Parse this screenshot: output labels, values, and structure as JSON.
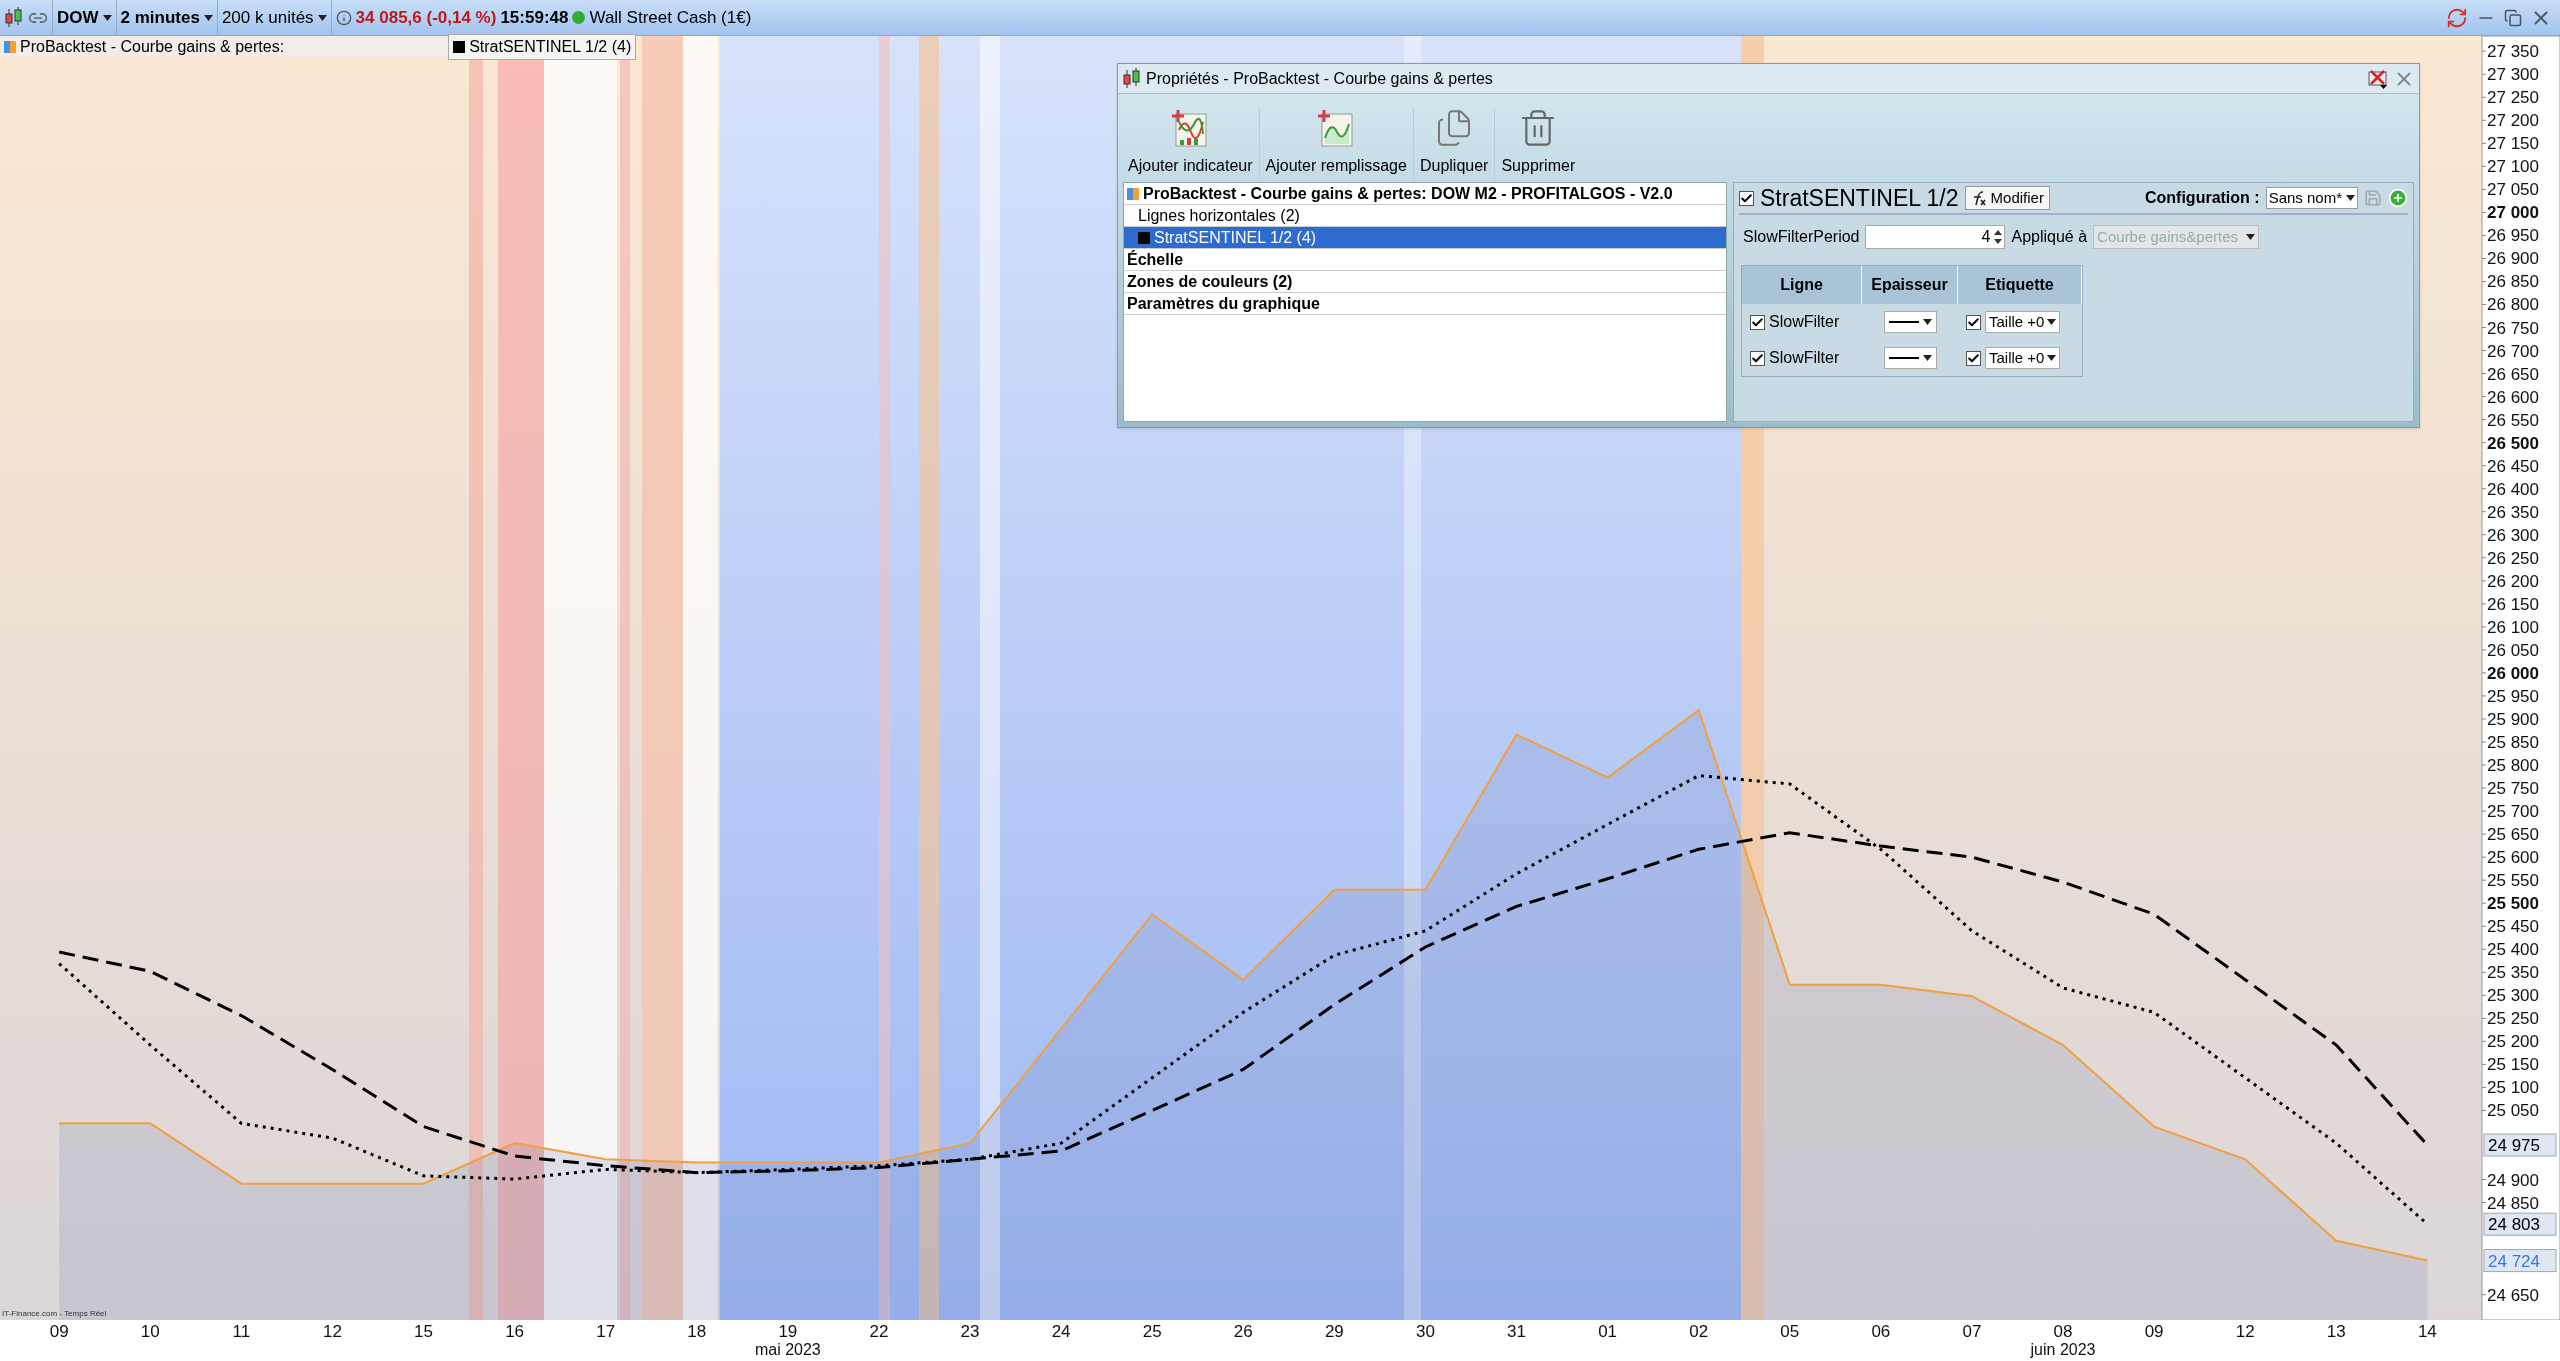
{
  "toolbar": {
    "symbol": "DOW",
    "timeframe": "2 minutes",
    "quantity": "200 k unités",
    "price": "34 085,6 (-0,14 %)",
    "time": "15:59:48",
    "market_open": true,
    "market": "Wall Street Cash (1€)"
  },
  "legend": [
    {
      "label": "ProBacktest - Courbe gains & pertes:",
      "kind": "backtest"
    },
    {
      "label": "StratSENTINEL 1/2 (4)",
      "kind": "indicator",
      "color": "#000000"
    }
  ],
  "chart": {
    "source": "IT-Finance.com - Temps Réel",
    "months": [
      {
        "label": "mai 2023"
      },
      {
        "label": "juin 2023"
      }
    ],
    "price_tags": [
      {
        "label": "24 975"
      },
      {
        "label": "24 803"
      },
      {
        "label": "24 724"
      }
    ],
    "chart_data": {
      "type": "line",
      "categories": [
        "09",
        "10",
        "11",
        "12",
        "15",
        "16",
        "17",
        "18",
        "19",
        "22",
        "23",
        "24",
        "25",
        "26",
        "29",
        "30",
        "31",
        "01",
        "02",
        "05",
        "06",
        "07",
        "08",
        "09",
        "12",
        "13",
        "14"
      ],
      "ylim": [
        24595,
        27383
      ],
      "series": [
        {
          "color": "#f0a040",
          "line_style": "solid",
          "values": [
            25022,
            25022,
            24891,
            24891,
            24891,
            24979,
            24944,
            24937,
            24937,
            24937,
            24979,
            25227,
            25476,
            25334,
            25529,
            25529,
            25866,
            25773,
            25919,
            25323,
            25323,
            25298,
            25192,
            25015,
            24944,
            24767,
            24724
          ]
        },
        {
          "color": "#000000",
          "line_style": "dashed",
          "values": [
            25394,
            25352,
            25256,
            25139,
            25015,
            24951,
            24930,
            24915,
            24919,
            24926,
            24944,
            24962,
            25050,
            25139,
            25280,
            25405,
            25493,
            25553,
            25617,
            25653,
            25624,
            25600,
            25546,
            25476,
            25334,
            25192,
            24975
          ]
        },
        {
          "color": "#000000",
          "line_style": "dotted",
          "values": [
            25369,
            25192,
            25022,
            24990,
            24908,
            24901,
            24922,
            24915,
            24922,
            24930,
            24944,
            24979,
            25121,
            25263,
            25387,
            25440,
            25564,
            25671,
            25777,
            25759,
            25617,
            25440,
            25316,
            25263,
            25121,
            24979,
            24803
          ]
        }
      ],
      "yticks": [
        {
          "value": 27350,
          "label": "27 350"
        },
        {
          "value": 27300,
          "label": "27 300"
        },
        {
          "value": 27250,
          "label": "27 250"
        },
        {
          "value": 27200,
          "label": "27 200"
        },
        {
          "value": 27150,
          "label": "27 150"
        },
        {
          "value": 27100,
          "label": "27 100"
        },
        {
          "value": 27050,
          "label": "27 050"
        },
        {
          "value": 27000,
          "label": "27 000"
        },
        {
          "value": 26950,
          "label": "26 950"
        },
        {
          "value": 26900,
          "label": "26 900"
        },
        {
          "value": 26850,
          "label": "26 850"
        },
        {
          "value": 26800,
          "label": "26 800"
        },
        {
          "value": 26750,
          "label": "26 750"
        },
        {
          "value": 26700,
          "label": "26 700"
        },
        {
          "value": 26650,
          "label": "26 650"
        },
        {
          "value": 26600,
          "label": "26 600"
        },
        {
          "value": 26550,
          "label": "26 550"
        },
        {
          "value": 26500,
          "label": "26 500"
        },
        {
          "value": 26450,
          "label": "26 450"
        },
        {
          "value": 26400,
          "label": "26 400"
        },
        {
          "value": 26350,
          "label": "26 350"
        },
        {
          "value": 26300,
          "label": "26 300"
        },
        {
          "value": 26250,
          "label": "26 250"
        },
        {
          "value": 26200,
          "label": "26 200"
        },
        {
          "value": 26150,
          "label": "26 150"
        },
        {
          "value": 26100,
          "label": "26 100"
        },
        {
          "value": 26050,
          "label": "26 050"
        },
        {
          "value": 26000,
          "label": "26 000"
        },
        {
          "value": 25950,
          "label": "25 950"
        },
        {
          "value": 25900,
          "label": "25 900"
        },
        {
          "value": 25850,
          "label": "25 850"
        },
        {
          "value": 25800,
          "label": "25 800"
        },
        {
          "value": 25750,
          "label": "25 750"
        },
        {
          "value": 25700,
          "label": "25 700"
        },
        {
          "value": 25650,
          "label": "25 650"
        },
        {
          "value": 25600,
          "label": "25 600"
        },
        {
          "value": 25550,
          "label": "25 550"
        },
        {
          "value": 25500,
          "label": "25 500"
        },
        {
          "value": 25450,
          "label": "25 450"
        },
        {
          "value": 25400,
          "label": "25 400"
        },
        {
          "value": 25350,
          "label": "25 350"
        },
        {
          "value": 25300,
          "label": "25 300"
        },
        {
          "value": 25250,
          "label": "25 250"
        },
        {
          "value": 25200,
          "label": "25 200"
        },
        {
          "value": 25150,
          "label": "25 150"
        },
        {
          "value": 25100,
          "label": "25 100"
        },
        {
          "value": 25050,
          "label": "25 050"
        },
        {
          "value": 24900,
          "label": "24 900"
        },
        {
          "value": 24850,
          "label": "24 850"
        },
        {
          "value": 24650,
          "label": "24 650"
        }
      ]
    }
  },
  "dialog": {
    "title": "Propriétés - ProBacktest - Courbe gains & pertes",
    "actions": [
      {
        "label": "Ajouter indicateur",
        "kind": "add_indicator"
      },
      {
        "label": "Ajouter remplissage",
        "kind": "add_fill"
      },
      {
        "label": "Dupliquer",
        "kind": "duplicate"
      },
      {
        "label": "Supprimer",
        "kind": "delete"
      }
    ],
    "tree": [
      {
        "label": "ProBacktest - Courbe gains & pertes: DOW M2 - PROFITALGOS - V2.0",
        "kind": "backtest",
        "bold": true,
        "selected": false,
        "children": [
          {
            "label": "Lignes horizontales (2)",
            "kind": "plain",
            "bold": false,
            "selected": false
          },
          {
            "label": "StratSENTINEL 1/2 (4)",
            "kind": "indicator",
            "color": "#000000",
            "bold": false,
            "selected": true
          }
        ]
      },
      {
        "label": "Échelle",
        "kind": "plain",
        "bold": true,
        "selected": false
      },
      {
        "label": "Zones de couleurs (2)",
        "kind": "plain",
        "bold": true,
        "selected": false
      },
      {
        "label": "Paramètres du graphique",
        "kind": "plain",
        "bold": true,
        "selected": false
      }
    ],
    "indicator": {
      "enabled": true,
      "name": "StratSENTINEL 1/2",
      "edit_label": "Modifier",
      "config_label": "Configuration :",
      "config_value": "Sans nom*",
      "save_disabled": true
    },
    "params": [
      {
        "label": "SlowFilterPeriod",
        "value": "4",
        "applied_label": "Appliqué à",
        "applied_value": "Courbe gains&pertes",
        "applied_disabled": true
      }
    ],
    "lines_table": {
      "columns": [
        "Ligne",
        "Epaisseur",
        "Etiquette"
      ],
      "rows": [
        {
          "visible": true,
          "name": "SlowFilter",
          "label_on": true,
          "label_size": "Taille +0"
        },
        {
          "visible": true,
          "name": "SlowFilter",
          "label_on": true,
          "label_size": "Taille +0"
        }
      ]
    }
  }
}
